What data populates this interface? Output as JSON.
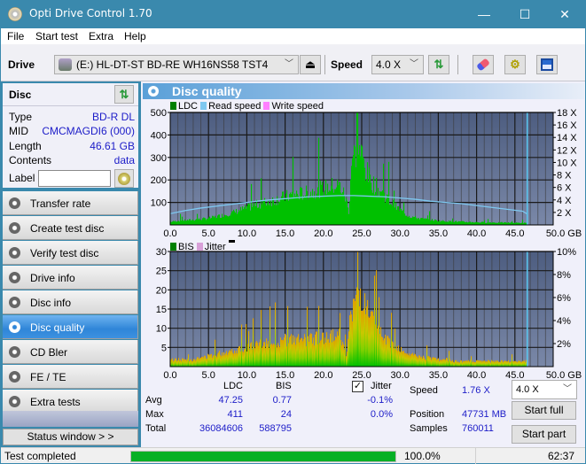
{
  "window": {
    "title": "Opti Drive Control 1.70",
    "minimize_glyph": "—",
    "maximize_glyph": "☐",
    "close_glyph": "✕"
  },
  "menu": [
    "File",
    "Start test",
    "Extra",
    "Help"
  ],
  "toolbar": {
    "drive_label": "Drive",
    "drive_value": "(E:)  HL-DT-ST BD-RE  WH16NS58 TST4",
    "speed_label": "Speed",
    "speed_value": "4.0 X",
    "eject_glyph": "⏏",
    "icons": [
      "refresh-icon",
      "eraser-icon",
      "settings-icon",
      "save-icon"
    ]
  },
  "disc": {
    "heading": "Disc",
    "fields": [
      {
        "key": "Type",
        "value": "BD-R DL"
      },
      {
        "key": "MID",
        "value": "CMCMAGDI6 (000)"
      },
      {
        "key": "Length",
        "value": "46.61 GB"
      },
      {
        "key": "Contents",
        "value": "data"
      }
    ],
    "label_key": "Label",
    "label_value": ""
  },
  "nav": {
    "items": [
      {
        "label": "Transfer rate",
        "active": false
      },
      {
        "label": "Create test disc",
        "active": false
      },
      {
        "label": "Verify test disc",
        "active": false
      },
      {
        "label": "Drive info",
        "active": false
      },
      {
        "label": "Disc info",
        "active": false
      },
      {
        "label": "Disc quality",
        "active": true
      },
      {
        "label": "CD Bler",
        "active": false
      },
      {
        "label": "FE / TE",
        "active": false
      },
      {
        "label": "Extra tests",
        "active": false
      }
    ],
    "status_window": "Status window > >"
  },
  "panel": {
    "title": "Disc quality"
  },
  "colors": {
    "ldc": "#00c000",
    "read_speed": "#7ec8f0",
    "write_speed": "#ff80ff",
    "bis": "#00c000",
    "jitter": "#d8a0d8",
    "plot_bg_top": "#4d5d80",
    "plot_bg_bottom": "#7a88a8",
    "accent": "#2f86d8",
    "value_text": "#1c1cc8",
    "progress": "#06b025"
  },
  "chart_data": [
    {
      "type": "area",
      "title": "LDC",
      "legend": [
        "LDC",
        "Read speed",
        "Write speed"
      ],
      "legend_position": "top-left",
      "xlabel": "GB",
      "x_ticks": [
        "0.0",
        "5.0",
        "10.0",
        "15.0",
        "20.0",
        "25.0",
        "30.0",
        "35.0",
        "40.0",
        "45.0",
        "50.0 GB"
      ],
      "xlim": [
        0,
        50
      ],
      "y_ticks_left": [
        "100",
        "200",
        "300",
        "400",
        "500"
      ],
      "ylim_left": [
        0,
        500
      ],
      "y_ticks_right": [
        "2 X",
        "4 X",
        "6 X",
        "8 X",
        "10 X",
        "12 X",
        "14 X",
        "16 X",
        "18 X"
      ],
      "ylim_right": [
        0,
        18
      ],
      "grid": true,
      "end_marker_gb": 46.61,
      "series": [
        {
          "name": "LDC",
          "x": [
            0,
            1,
            2,
            3,
            4,
            5,
            6,
            7,
            8,
            9,
            10,
            11,
            12,
            13,
            14,
            15,
            16,
            17,
            18,
            19,
            20,
            21,
            22,
            22.5,
            23,
            23.3,
            23.6,
            24,
            24.5,
            25,
            25.5,
            26,
            27,
            28,
            29,
            30,
            31,
            32,
            33,
            34,
            35,
            36,
            37,
            38,
            39,
            40,
            41,
            42,
            43,
            44,
            45,
            46,
            46.6
          ],
          "values": [
            15,
            20,
            22,
            25,
            28,
            32,
            40,
            48,
            58,
            70,
            82,
            95,
            105,
            115,
            125,
            135,
            145,
            150,
            155,
            165,
            175,
            185,
            190,
            160,
            110,
            60,
            310,
            340,
            360,
            330,
            260,
            220,
            175,
            140,
            100,
            70,
            45,
            35,
            28,
            25,
            20,
            18,
            17,
            15,
            14,
            13,
            12,
            12,
            11,
            11,
            10,
            10,
            8
          ]
        },
        {
          "name": "Read speed",
          "unit": "X",
          "x": [
            0,
            2,
            4,
            6,
            8,
            10,
            12,
            14,
            16,
            18,
            20,
            22,
            24,
            26,
            28,
            30,
            32,
            34,
            36,
            38,
            40,
            42,
            44,
            46,
            46.6
          ],
          "values": [
            1.8,
            2.3,
            2.7,
            3.0,
            3.3,
            3.6,
            3.9,
            4.1,
            4.3,
            4.5,
            4.6,
            4.7,
            4.7,
            4.6,
            4.5,
            4.3,
            4.1,
            3.8,
            3.6,
            3.4,
            3.1,
            2.8,
            2.5,
            2.2,
            1.76
          ]
        },
        {
          "name": "Write speed",
          "unit": "X",
          "x": [],
          "values": []
        }
      ]
    },
    {
      "type": "area",
      "title": "BIS",
      "legend": [
        "BIS",
        "Jitter"
      ],
      "legend_position": "top-left",
      "xlabel": "GB",
      "x_ticks": [
        "0.0",
        "5.0",
        "10.0",
        "15.0",
        "20.0",
        "25.0",
        "30.0",
        "35.0",
        "40.0",
        "45.0",
        "50.0 GB"
      ],
      "xlim": [
        0,
        50
      ],
      "y_ticks_left": [
        "5",
        "10",
        "15",
        "20",
        "25",
        "30"
      ],
      "ylim_left": [
        0,
        30
      ],
      "y_ticks_right": [
        "2%",
        "4%",
        "6%",
        "8%",
        "10%"
      ],
      "ylim_right": [
        0,
        10
      ],
      "grid": true,
      "end_marker_gb": 46.61,
      "series": [
        {
          "name": "BIS",
          "x": [
            0,
            1,
            2,
            3,
            4,
            5,
            6,
            7,
            8,
            9,
            10,
            11,
            12,
            13,
            14,
            15,
            16,
            17,
            18,
            19,
            20,
            21,
            22,
            22.5,
            23,
            23.5,
            24,
            24.5,
            25,
            25.5,
            26,
            26.5,
            27,
            28,
            29,
            30,
            31,
            32,
            33,
            34,
            35,
            36,
            37,
            38,
            39,
            40,
            41,
            42,
            43,
            44,
            45,
            46,
            46.6
          ],
          "values": [
            2,
            2,
            2,
            2,
            2.5,
            3,
            3.5,
            4,
            4.5,
            5,
            5.5,
            6,
            6.5,
            7,
            7,
            7.5,
            7.5,
            7.5,
            7.5,
            8,
            8,
            8.5,
            9,
            7,
            3,
            15,
            18,
            20,
            19,
            16,
            14,
            12,
            10,
            8,
            6,
            5,
            3.5,
            3,
            2.5,
            2.5,
            2,
            2,
            1.5,
            1.5,
            1.5,
            1.5,
            1.5,
            1.5,
            1.5,
            1.5,
            1.5,
            1.5,
            1.5
          ]
        },
        {
          "name": "Jitter",
          "x": [],
          "values": []
        }
      ]
    }
  ],
  "stats": {
    "col_ldc": "LDC",
    "col_bis": "BIS",
    "jitter_checked": true,
    "jitter_label": "Jitter",
    "rows": [
      {
        "label": "Avg",
        "ldc": "47.25",
        "bis": "0.77",
        "jitter": "-0.1%"
      },
      {
        "label": "Max",
        "ldc": "411",
        "bis": "24",
        "jitter": "0.0%"
      },
      {
        "label": "Total",
        "ldc": "36084606",
        "bis": "588795",
        "jitter": ""
      }
    ],
    "speed_label": "Speed",
    "speed_value": "1.76 X",
    "position_label": "Position",
    "position_value": "47731 MB",
    "samples_label": "Samples",
    "samples_value": "760011",
    "speed_select": "4.0 X",
    "start_full": "Start full",
    "start_part": "Start part"
  },
  "statusbar": {
    "text": "Test completed",
    "progress_percent": 100,
    "progress_text": "100.0%",
    "elapsed": "62:37"
  }
}
